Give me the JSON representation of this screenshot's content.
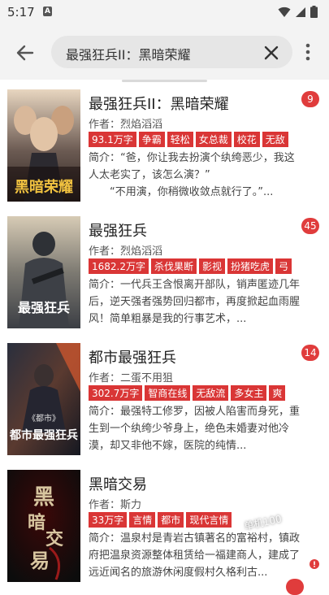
{
  "status_bar": {
    "time": "5:17",
    "notif_letter": "A"
  },
  "search": {
    "query": "最强狂兵II：黑暗荣耀"
  },
  "books": [
    {
      "title": "最强狂兵II：黑暗荣耀",
      "badge": "9",
      "author": "作者：烈焰滔滔",
      "tags": [
        "93.1万字",
        "争霸",
        "轻松",
        "女总裁",
        "校花",
        "无敌"
      ],
      "intro": "简介：“爸，你让我去扮演个纨绔恶少，我这人太老实了，该怎么演？”\n　　“不用演，你稍微收敛点就行了。”...",
      "cover_text": "黑暗荣耀",
      "cover_colors": [
        "#3a3230",
        "#c9a27a"
      ]
    },
    {
      "title": "最强狂兵",
      "badge": "45",
      "author": "作者：烈焰滔滔",
      "tags": [
        "1682.2万字",
        "杀伐果断",
        "影视",
        "扮猪吃虎",
        "弓"
      ],
      "intro": "简介：一代兵王含恨离开部队，销声匿迹几年后，逆天强者强势回归都市，再度掀起血雨腥风！简单粗暴是我的行事艺术，...",
      "cover_text": "最强狂兵",
      "cover_colors": [
        "#5a6470",
        "#c9b89a"
      ]
    },
    {
      "title": "都市最强狂兵",
      "badge": "14",
      "author": "作者：二蛋不用狙",
      "tags": [
        "302.7万字",
        "智商在线",
        "无敌流",
        "多女主",
        "爽"
      ],
      "intro": "简介：最强特工修罗，因被人陷害而身死，重生到一个纨绔少爷身上，绝色未婚妻对他冷漠，却又非他不嫁，医院的纯情...",
      "cover_text": "都市最强狂兵",
      "cover_colors": [
        "#1c1f2a",
        "#b2452c"
      ]
    },
    {
      "title": "黑暗交易",
      "badge": "",
      "author": "作者：斯力",
      "tags": [
        "33万字",
        "言情",
        "都市",
        "现代言情"
      ],
      "intro": "简介：温泉村是青岩古镇著名的富裕村，镇政府把温泉资源整体租赁给一福建商人，建成了远近闻名的旅游休闲度假村久格利古...",
      "cover_text": "黑暗交易",
      "cover_colors": [
        "#1a1a1a",
        "#7a1010"
      ]
    }
  ],
  "watermark": "单机100"
}
